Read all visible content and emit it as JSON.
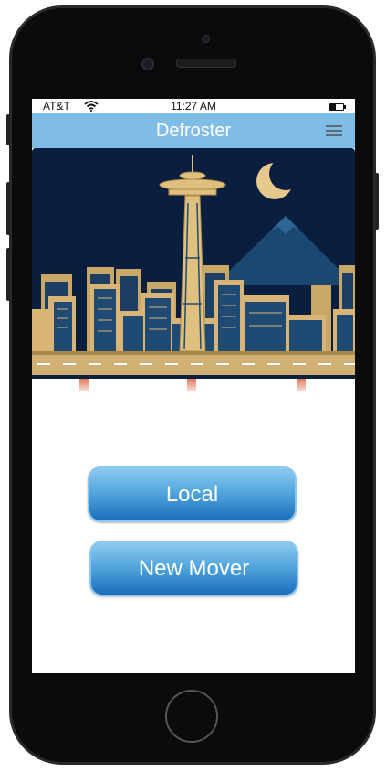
{
  "status_bar": {
    "carrier": "AT&T",
    "time": "11:27 AM",
    "wifi_icon": "wifi-icon",
    "battery_icon": "battery-icon",
    "battery_level": 0.4
  },
  "nav_bar": {
    "title": "Defroster",
    "menu_icon": "hamburger-menu-icon"
  },
  "hero": {
    "illustration": "seattle-skyline-night"
  },
  "actions": {
    "local_label": "Local",
    "new_mover_label": "New Mover"
  },
  "colors": {
    "nav_bar": "#80bde6",
    "button_top": "#8fcaf0",
    "button_bottom": "#1a6fbd",
    "sky": "#0a1f3f",
    "buildings": "#d8b476"
  }
}
